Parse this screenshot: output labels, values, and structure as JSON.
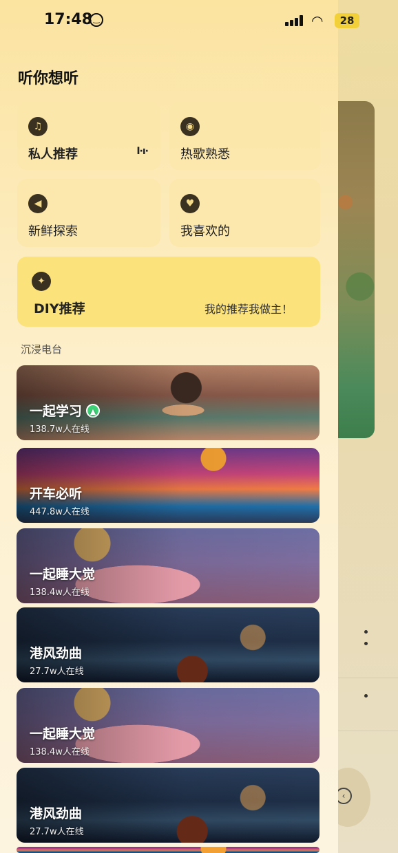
{
  "status_bar": {
    "time": "17:48",
    "battery": "28"
  },
  "drawer": {
    "title": "听你想听",
    "tiles": [
      {
        "label": "私人推荐",
        "icon": "music-note-icon"
      },
      {
        "label": "热歌熟悉",
        "icon": "record-icon"
      },
      {
        "label": "新鲜探索",
        "icon": "compass-icon"
      },
      {
        "label": "我喜欢的",
        "icon": "heart-icon"
      }
    ],
    "diy": {
      "label": "DIY推荐",
      "slogan": "我的推荐我做主！",
      "icon": "sparkle-icon"
    },
    "section_label": "沉浸电台",
    "radios": [
      {
        "name": "一起学习",
        "count": "138.7w人在线"
      },
      {
        "name": "开车必听",
        "count": "447.8w人在线"
      },
      {
        "name": "一起睡大觉",
        "count": "138.4w人在线"
      },
      {
        "name": "港风劲曲",
        "count": "27.7w人在线"
      },
      {
        "name": "一起睡大觉",
        "count": "138.4w人在线"
      },
      {
        "name": "港风劲曲",
        "count": "27.7w人在线"
      }
    ]
  }
}
